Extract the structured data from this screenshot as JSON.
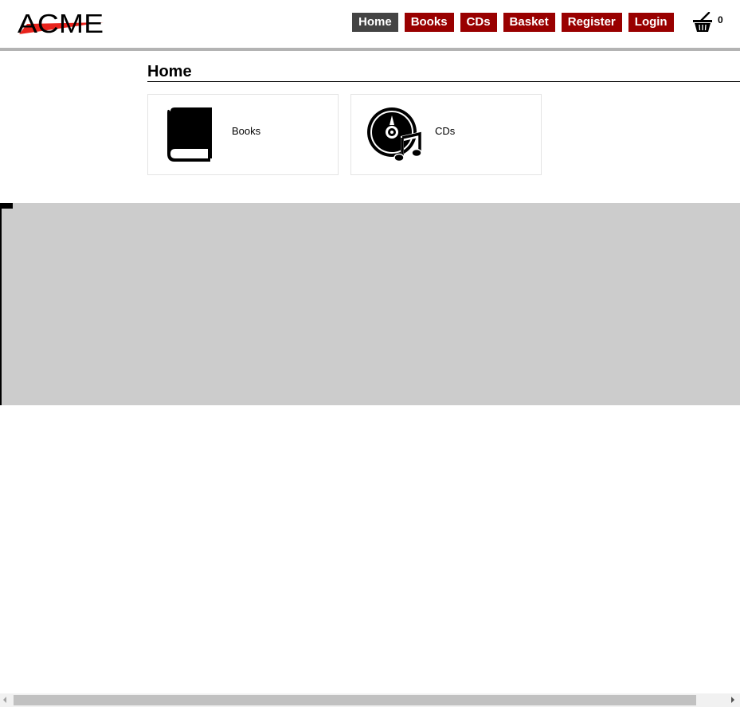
{
  "header": {
    "logo_text": "ACME",
    "nav": [
      {
        "label": "Home",
        "active": true
      },
      {
        "label": "Books",
        "active": false
      },
      {
        "label": "CDs",
        "active": false
      },
      {
        "label": "Basket",
        "active": false
      },
      {
        "label": "Register",
        "active": false
      },
      {
        "label": "Login",
        "active": false
      }
    ],
    "basket_count": "0"
  },
  "main": {
    "title": "Home",
    "tiles": [
      {
        "label": "Books",
        "icon": "book-icon"
      },
      {
        "label": "CDs",
        "icon": "cd-music-icon"
      }
    ]
  },
  "colors": {
    "nav_bg": "#990000",
    "nav_active_bg": "#444444",
    "logo_accent": "#e8231c",
    "frame_bg": "#cccccc"
  }
}
